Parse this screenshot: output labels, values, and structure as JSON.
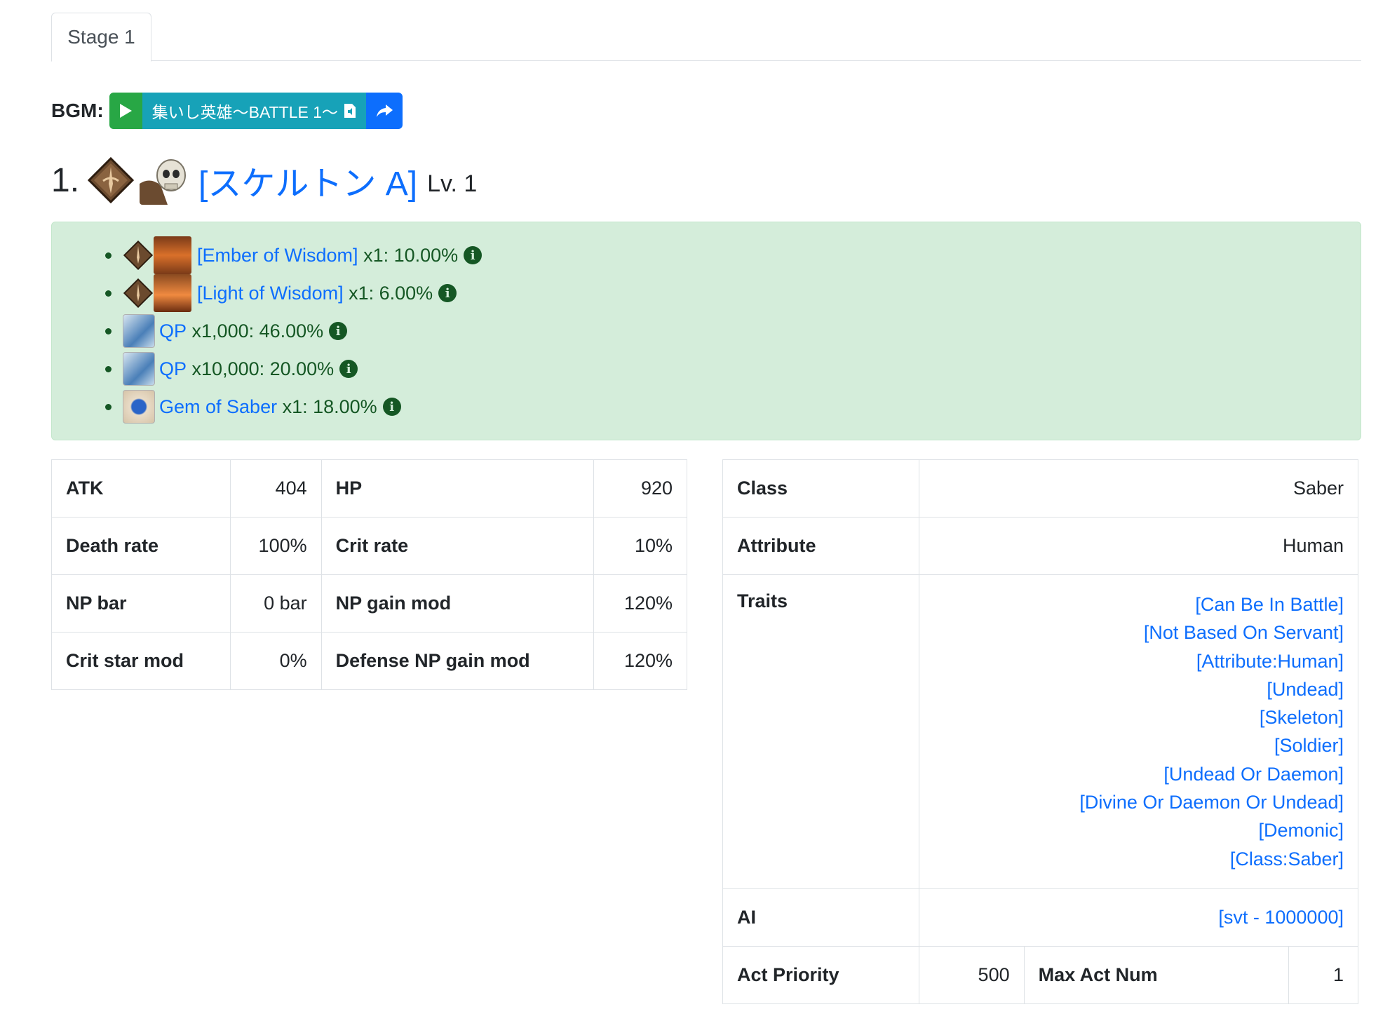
{
  "tabs": [
    {
      "label": "Stage 1"
    }
  ],
  "bgm": {
    "label": "BGM:",
    "title": "集いし英雄〜BATTLE 1〜"
  },
  "enemy": {
    "number": "1.",
    "name": "[スケルトン A]",
    "level": "Lv. 1"
  },
  "drops": [
    {
      "name": "[Ember of Wisdom]",
      "detail": "x1: 10.00%"
    },
    {
      "name": "[Light of Wisdom]",
      "detail": "x1: 6.00%"
    },
    {
      "name": "QP",
      "detail": "x1,000: 46.00%"
    },
    {
      "name": "QP",
      "detail": "x10,000: 20.00%"
    },
    {
      "name": "Gem of Saber",
      "detail": "x1: 18.00%"
    }
  ],
  "stats": {
    "rows": [
      {
        "k1": "ATK",
        "v1": "404",
        "k2": "HP",
        "v2": "920"
      },
      {
        "k1": "Death rate",
        "v1": "100%",
        "k2": "Crit rate",
        "v2": "10%"
      },
      {
        "k1": "NP bar",
        "v1": "0 bar",
        "k2": "NP gain mod",
        "v2": "120%"
      },
      {
        "k1": "Crit star mod",
        "v1": "0%",
        "k2": "Defense NP gain mod",
        "v2": "120%"
      }
    ]
  },
  "info": {
    "class_label": "Class",
    "class_value": "Saber",
    "attribute_label": "Attribute",
    "attribute_value": "Human",
    "traits_label": "Traits",
    "traits": [
      "[Can Be In Battle]",
      "[Not Based On Servant]",
      "[Attribute:Human]",
      "[Undead]",
      "[Skeleton]",
      "[Soldier]",
      "[Undead Or Daemon]",
      "[Divine Or Daemon Or Undead]",
      "[Demonic]",
      "[Class:Saber]"
    ],
    "ai_label": "AI",
    "ai_value": "[svt - 1000000]",
    "act_priority_label": "Act Priority",
    "act_priority_value": "500",
    "max_act_num_label": "Max Act Num",
    "max_act_num_value": "1"
  },
  "colors": {
    "link": "#0d6efd",
    "success_bg": "#d4edda",
    "success_text": "#155724",
    "play_green": "#28a745",
    "bgm_teal": "#17a2b8"
  }
}
